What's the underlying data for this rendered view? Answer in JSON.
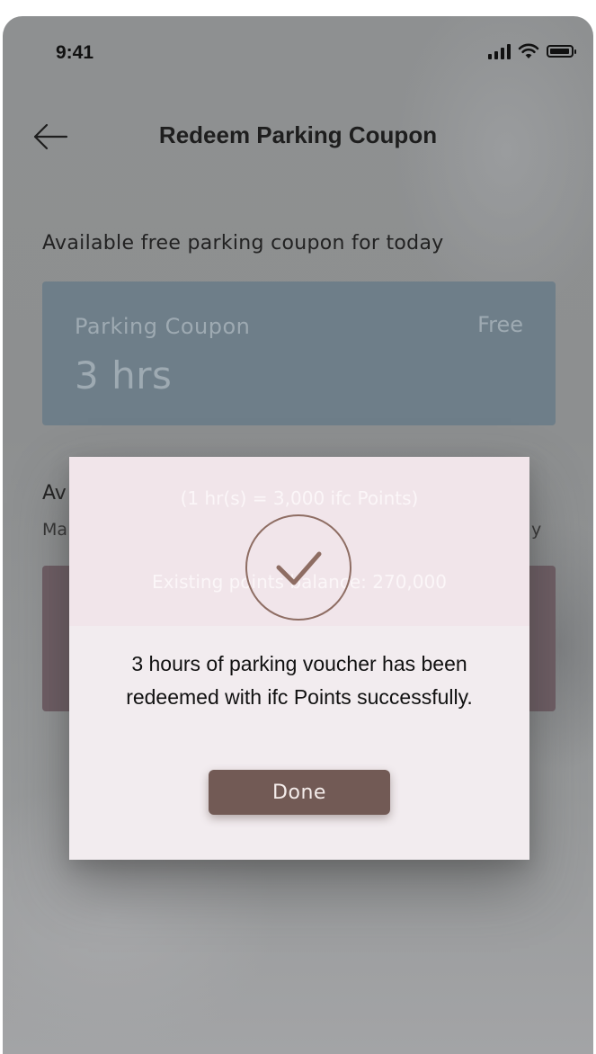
{
  "status_bar": {
    "time": "9:41",
    "icons": [
      "signal-icon",
      "wifi-icon",
      "battery-icon"
    ]
  },
  "header": {
    "back_icon": "arrow-left-icon",
    "title": "Redeem Parking Coupon"
  },
  "free_section": {
    "label": "Available free parking coupon for today",
    "coupon": {
      "name": "Parking Coupon",
      "hours": "3 hrs",
      "price": "Free"
    }
  },
  "paid_section": {
    "title_visible": "Av",
    "subtitle_left_visible": "Ma",
    "subtitle_right_visible": "y"
  },
  "dialog": {
    "rate_text": "(1 hr(s) = 3,000 ifc Points)",
    "balance_text": "Existing points balance: 270,000",
    "icon": "check-circle-icon",
    "message": "3 hours of parking voucher has been redeemed with ifc Points successfully.",
    "done_label": "Done"
  },
  "colors": {
    "overlay_gray": "#8e9091",
    "free_card": "#6e7e89",
    "paid_card": "#6f5e65",
    "accent_brown": "#725a55",
    "dialog_bg": "#f2ecef"
  }
}
